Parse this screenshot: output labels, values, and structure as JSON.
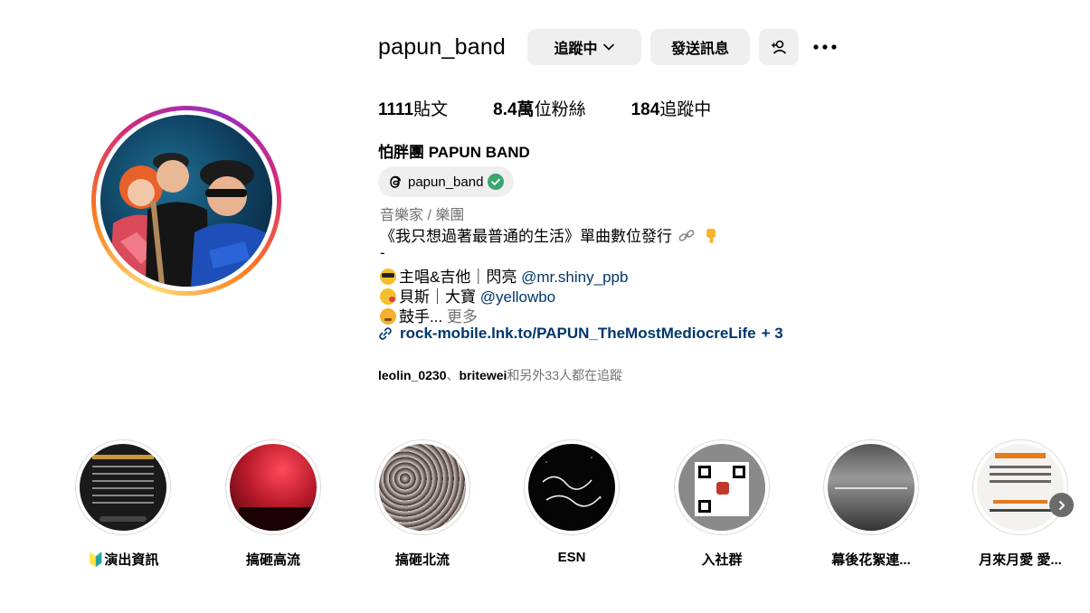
{
  "profile": {
    "username": "papun_band",
    "following_button": "追蹤中",
    "message_button": "發送訊息",
    "stats": {
      "posts_count": "1111",
      "posts_label": "貼文",
      "followers_count": "8.4萬",
      "followers_label": "位粉絲",
      "following_count": "184",
      "following_label": "追蹤中"
    },
    "full_name": "怕胖團 PAPUN BAND",
    "threads_handle": "papun_band",
    "category": "音樂家 / 樂團",
    "bio": {
      "line1": "《我只想過著最普通的生活》單曲數位發行",
      "line2": "-",
      "line3_text": "主唱&吉他｜閃亮 ",
      "line3_mention": "@mr.shiny_ppb",
      "line4_text": "貝斯｜大寶 ",
      "line4_mention": "@yellowbo",
      "line5_text": "鼓手... ",
      "more": "更多"
    },
    "link": {
      "url": "rock-mobile.lnk.to/PAPUN_TheMostMediocreLife",
      "extra": "+ 3"
    },
    "followed_by": {
      "user1": "leolin_0230",
      "separator": "、",
      "user2": "britewei",
      "rest": "和另外33人都在追蹤"
    }
  },
  "highlights": [
    {
      "label": "🔰演出資訊"
    },
    {
      "label": "搞砸高流"
    },
    {
      "label": "搞砸北流"
    },
    {
      "label": "ESN"
    },
    {
      "label": "入社群"
    },
    {
      "label": "幕後花絮連..."
    },
    {
      "label": "月來月愛 愛..."
    }
  ],
  "icons": {
    "following_chevron": "chevron-down-icon",
    "add_user": "add-user-icon",
    "more": "more-options-icon",
    "threads": "threads-icon",
    "verified": "verified-badge-icon",
    "link": "link-icon",
    "next": "chevron-right-icon"
  },
  "colors": {
    "button_bg": "#efefef",
    "mention": "#00376b",
    "muted": "#737373",
    "verified": "#3ba56e"
  }
}
